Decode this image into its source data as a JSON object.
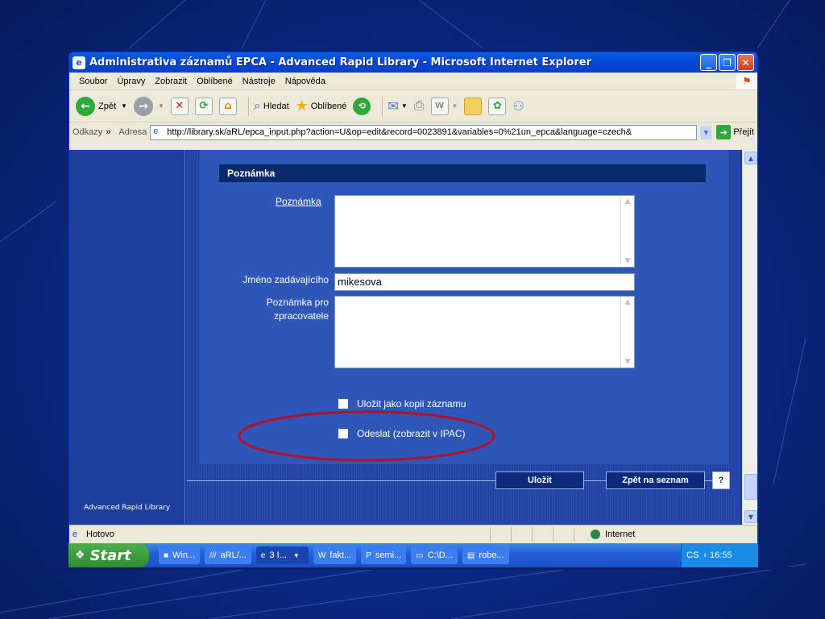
{
  "window": {
    "title": "Administrativa záznamů EPCA - Advanced Rapid Library - Microsoft Internet Explorer"
  },
  "menu": [
    "Soubor",
    "Úpravy",
    "Zobrazit",
    "Oblíbené",
    "Nástroje",
    "Nápověda"
  ],
  "toolbar": {
    "back_label": "Zpět",
    "search_label": "Hledat",
    "favorites_label": "Oblíbené"
  },
  "addressbar": {
    "links_label": "Odkazy",
    "address_label": "Adresa",
    "url": "http://library.sk/aRL/epca_input.php?action=U&op=edit&record=0023891&variables=0%21un_epca&language=czech&",
    "go_label": "Přejít"
  },
  "page": {
    "left_footer": "Advanced Rapid Library",
    "section_title": "Poznámka",
    "note_label": "Poznámka",
    "note_value": "",
    "entered_by_label": "Jméno zadávajícího",
    "entered_by_value": "mikesova",
    "processor_note_label_1": "Poznámka pro",
    "processor_note_label_2": "zpracovatele",
    "processor_note_value": "",
    "checkbox_copy_label": "Uložit jako kopii záznamu",
    "checkbox_copy_checked": false,
    "checkbox_send_label": "Odeslat (zobrazit v IPAC)",
    "checkbox_send_checked": false,
    "save_button": "Uložit",
    "back_to_list_button": "Zpět na seznam",
    "help_button": "?"
  },
  "statusbar": {
    "status_text": "Hotovo",
    "zone_text": "Internet"
  },
  "taskbar": {
    "start_label": "Start",
    "tasks": [
      "Win...",
      "aRL/...",
      "3 I...",
      "fakt...",
      "semi...",
      "C:\\D...",
      "robe..."
    ],
    "lang": "CS",
    "clock": "16:55"
  },
  "colors": {
    "desktop": "#0a2a86",
    "panel_blue": "#2f57b8",
    "section_header": "#0a2a6e",
    "highlight_ellipse": "#b3102a"
  }
}
